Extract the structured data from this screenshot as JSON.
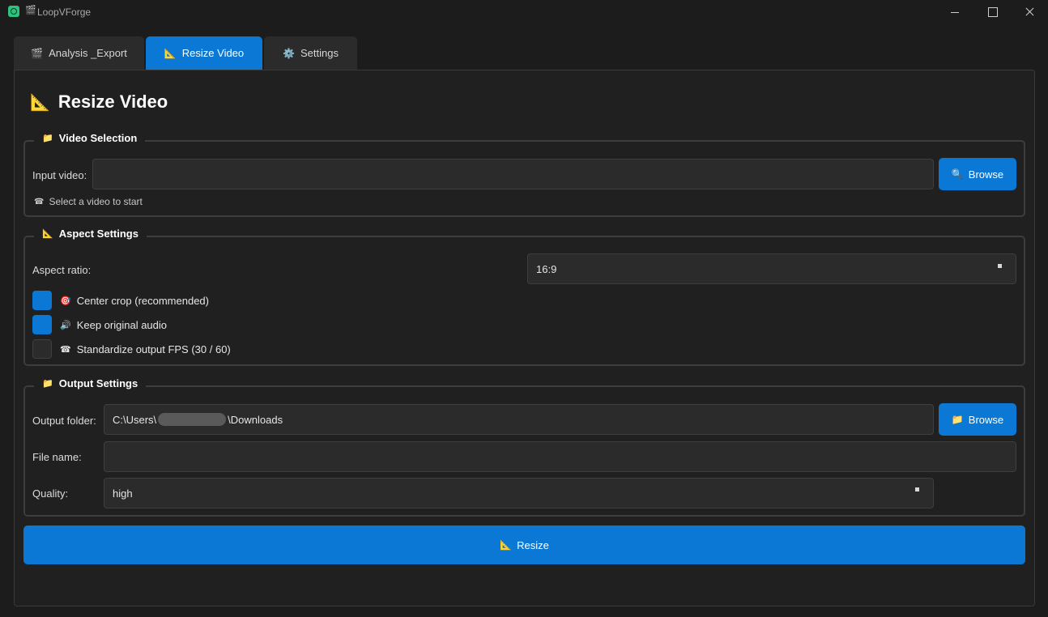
{
  "window": {
    "title": "LoopVForge",
    "title_emoji": "🎬"
  },
  "tabs": [
    {
      "emoji": "🎬",
      "label": "Analysis _Export",
      "active": false
    },
    {
      "emoji": "📐",
      "label": "Resize Video",
      "active": true
    },
    {
      "emoji": "⚙️",
      "label": "Settings",
      "active": false
    }
  ],
  "page": {
    "title_emoji": "📐",
    "title": "Resize Video"
  },
  "video_selection": {
    "legend_emoji": "📁",
    "legend": "Video Selection",
    "input_label": "Input video:",
    "input_value": "",
    "browse_emoji": "🔍",
    "browse_label": "Browse",
    "hint_emoji": "☎",
    "hint": "Select a video to start"
  },
  "aspect_settings": {
    "legend_emoji": "📐",
    "legend": "Aspect Settings",
    "ratio_label": "Aspect ratio:",
    "ratio_value": "16:9",
    "checkboxes": [
      {
        "emoji": "🎯",
        "label": "Center crop (recommended)",
        "checked": true
      },
      {
        "emoji": "🔊",
        "label": "Keep original audio",
        "checked": true
      },
      {
        "emoji": "☎",
        "label": "Standardize output FPS (30 / 60)",
        "checked": false
      }
    ]
  },
  "output_settings": {
    "legend_emoji": "📁",
    "legend": "Output Settings",
    "folder_label": "Output folder:",
    "folder_prefix": "C:\\Users\\",
    "folder_suffix": "\\Downloads",
    "browse_emoji": "📁",
    "browse_label": "Browse",
    "filename_label": "File name:",
    "filename_value": "",
    "quality_label": "Quality:",
    "quality_value": "high"
  },
  "resize_button": {
    "emoji": "📐",
    "label": "Resize"
  },
  "colors": {
    "accent": "#0a78d4",
    "background": "#1c1c1c",
    "panel": "#202020",
    "field": "#2b2b2b"
  }
}
